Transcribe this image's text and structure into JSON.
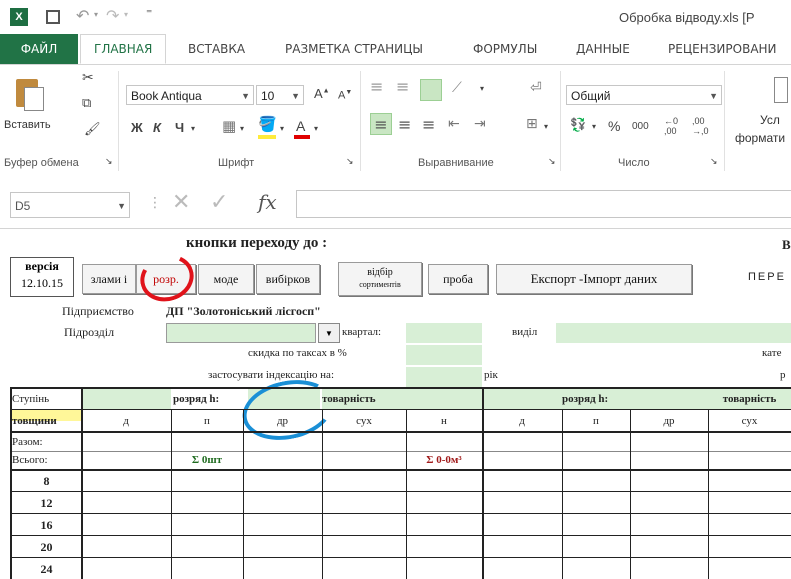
{
  "window": {
    "title": "Обробка відводу.xls [P",
    "app_icon": "excel-icon"
  },
  "tabs": [
    "ФАЙЛ",
    "ГЛАВНАЯ",
    "ВСТАВКА",
    "РАЗМЕТКА СТРАНИЦЫ",
    "ФОРМУЛЫ",
    "ДАННЫЕ",
    "РЕЦЕНЗИРОВАНИ"
  ],
  "ribbon": {
    "paste_label": "Вставить",
    "clipboard_group": "Буфер обмена",
    "font_name": "Book Antiqua",
    "font_size": "10",
    "bold": "Ж",
    "italic": "К",
    "underline": "Ч",
    "font_group": "Шрифт",
    "align_group": "Выравнивание",
    "number_format": "Общий",
    "percent": "%",
    "thousands": "000",
    "number_group": "Число",
    "cond_format_1": "Усл",
    "cond_format_2": "формати"
  },
  "formula_bar": {
    "name_box": "D5",
    "fx": "fx",
    "value": ""
  },
  "sheet": {
    "nav_title": "кнопки переходу до :",
    "version_label": "версія",
    "version_date": "12.10.15",
    "buttons": {
      "b1": "злами і",
      "b2": "розр.",
      "b3": "моде",
      "b4": "вибірков",
      "b5_1": "відбір",
      "b5_2": "сортиментів",
      "b6": "проба",
      "b7": "Експорт -Імпорт даних"
    },
    "right_top_1": "В",
    "right_top_2": "ПЕРЕ",
    "enterprise_label": "Підприємство",
    "enterprise_value": "ДП \"Золотоніський лісгосп\"",
    "subdivision_label": "Підрозділ",
    "quarter_label": "квартал:",
    "section_label": "виділ",
    "discount_label": "скидка по таксах в %",
    "category_label": "кате",
    "index_label": "застосувати індексацію на:",
    "year_label": "рік",
    "r_label": "р",
    "table": {
      "header1": [
        "Ступінь",
        "розряд h:",
        "товарність",
        "розряд h:",
        "товарність"
      ],
      "header2": [
        "товщини",
        "д",
        "п",
        "др",
        "сух",
        "н",
        "д",
        "п",
        "др",
        "сух"
      ],
      "row_total": "Разом:",
      "row_all": "Всього:",
      "sum_pcs": "Σ 0шт",
      "sum_vol": "Σ 0-0м³",
      "thickness": [
        "8",
        "12",
        "16",
        "20",
        "24"
      ]
    }
  }
}
